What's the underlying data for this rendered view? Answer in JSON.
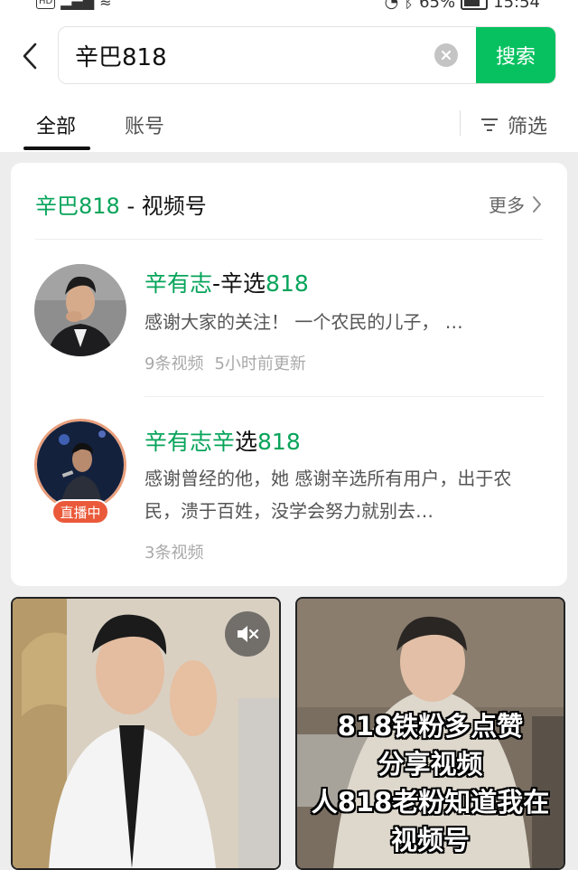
{
  "status_bar": {
    "left_badge": "HD",
    "battery": "65%",
    "time": "15:54"
  },
  "search": {
    "query": "辛巴818",
    "button_label": "搜索"
  },
  "tabs": {
    "all_label": "全部",
    "account_label": "账号",
    "filter_label": "筛选"
  },
  "section": {
    "keyword": "辛巴818",
    "title_suffix": " - 视频号",
    "more_label": "更多"
  },
  "accounts": [
    {
      "name_hl1": "辛有志",
      "name_plain": "-辛选",
      "name_hl2": "818",
      "description": "感谢大家的关注！ 一个农民的儿子， …",
      "video_count": "9条视频",
      "updated": "5小时前更新"
    },
    {
      "name_hl1": "辛有志辛",
      "name_plain": "选",
      "name_hl2": "818",
      "description": "感谢曾经的他，她 感谢辛选所有用户，出于农民，溃于百姓，没学会努力就别去…",
      "video_count": "3条视频",
      "live_badge": "直播中"
    }
  ],
  "videos": [
    {
      "muted": true,
      "overlay_lines": []
    },
    {
      "overlay_lines": [
        "818铁粉多点赞",
        "分享视频",
        "人818老粉知道我在",
        "视频号"
      ]
    }
  ],
  "colors": {
    "accent_green": "#07c160",
    "highlight_green": "#07a45a",
    "live_red": "#ea5a3a"
  },
  "icons": [
    "back-arrow-icon",
    "clear-icon",
    "filter-icon",
    "chevron-right-icon",
    "mute-icon"
  ]
}
